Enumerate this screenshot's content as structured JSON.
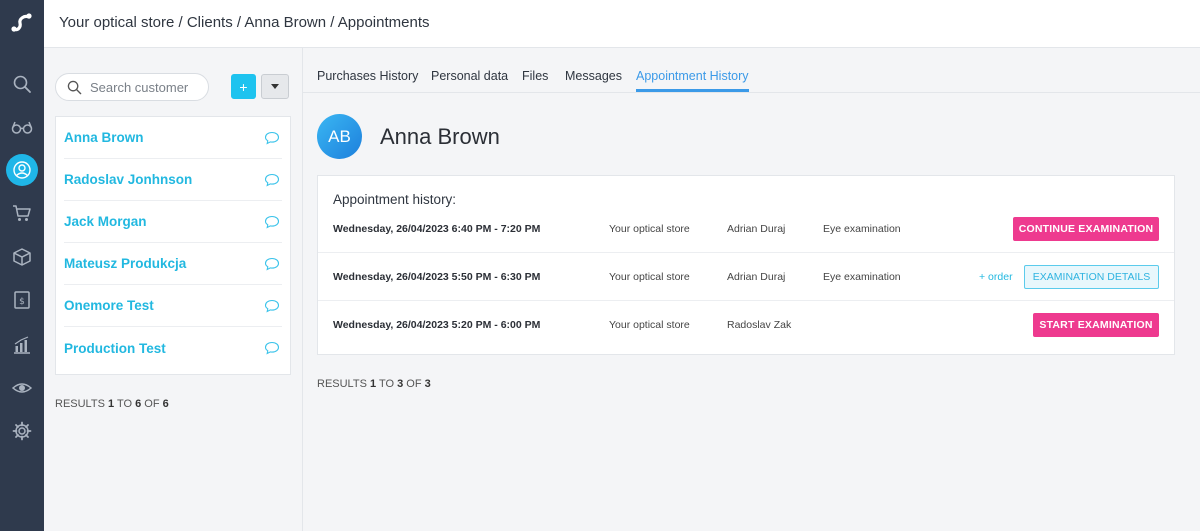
{
  "breadcrumb": "Your optical store / Clients / Anna Brown / Appointments",
  "nav_icons": [
    "logo-icon",
    "search-icon",
    "glasses-icon",
    "user-icon",
    "cart-icon",
    "box-icon",
    "invoice-icon",
    "chart-icon",
    "eye-icon",
    "gear-icon"
  ],
  "colors": {
    "rail": "#2f3a4d",
    "accent": "#1fb6e8",
    "tab_active": "#3b9ae8",
    "pink": "#ee3a8f"
  },
  "sidebar": {
    "search_placeholder": "Search customer",
    "add_label": "+",
    "clients": [
      {
        "name": "Anna Brown"
      },
      {
        "name": "Radoslav Jonhnson"
      },
      {
        "name": "Jack Morgan"
      },
      {
        "name": "Mateusz Produkcja"
      },
      {
        "name": "Onemore Test"
      },
      {
        "name": "Production Test"
      }
    ],
    "results": {
      "prefix": "RESULTS",
      "from": "1",
      "to_word": "TO",
      "to": "6",
      "of_word": "OF",
      "total": "6"
    }
  },
  "tabs": [
    {
      "label": "Purchases History"
    },
    {
      "label": "Personal data"
    },
    {
      "label": "Files"
    },
    {
      "label": "Messages"
    },
    {
      "label": "Appointment History"
    }
  ],
  "active_tab": "Appointment History",
  "client": {
    "initials": "AB",
    "name": "Anna Brown"
  },
  "history": {
    "title": "Appointment history:",
    "appointments": [
      {
        "datetime": "Wednesday, 26/04/2023 6:40 PM - 7:20 PM",
        "store": "Your optical store",
        "doctor": "Adrian Duraj",
        "type": "Eye examination",
        "action": "CONTINUE EXAMINATION"
      },
      {
        "datetime": "Wednesday, 26/04/2023 5:50 PM - 6:30 PM",
        "store": "Your optical store",
        "doctor": "Adrian Duraj",
        "type": "Eye examination",
        "order_link": "+ order",
        "action": "EXAMINATION DETAILS"
      },
      {
        "datetime": "Wednesday, 26/04/2023 5:20 PM - 6:00 PM",
        "store": "Your optical store",
        "doctor": "Radoslav Zak",
        "type": "",
        "action": "START EXAMINATION"
      }
    ],
    "results": {
      "prefix": "RESULTS",
      "from": "1",
      "to_word": "TO",
      "to": "3",
      "of_word": "OF",
      "total": "3"
    }
  }
}
